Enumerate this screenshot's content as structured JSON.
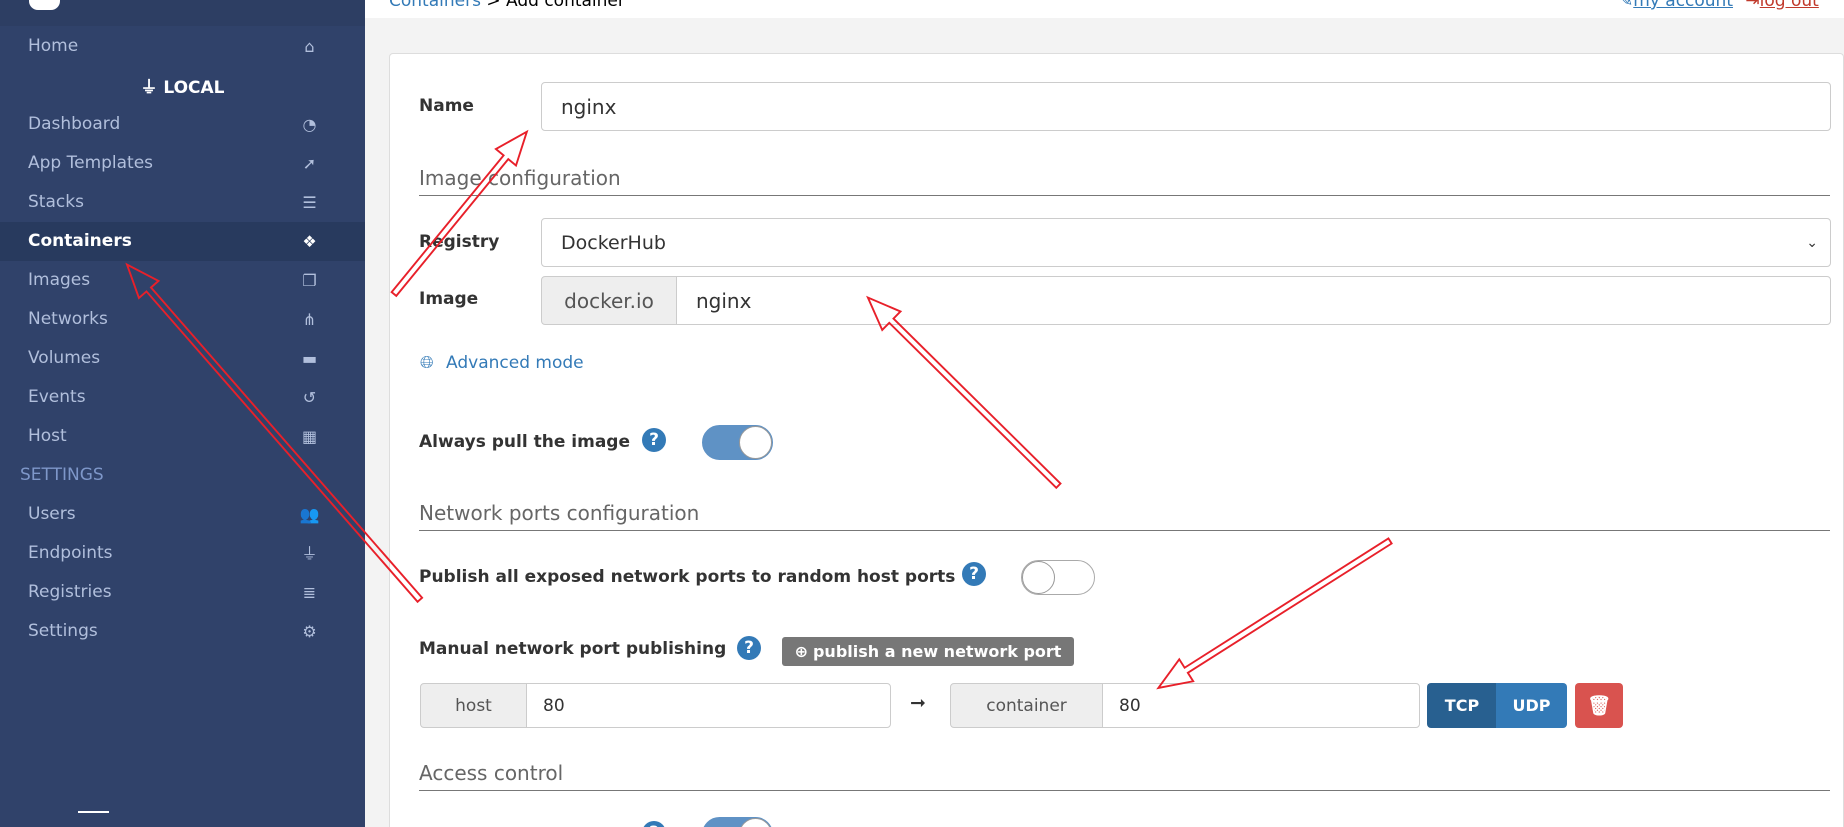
{
  "header": {
    "breadcrumb_link": "Containers",
    "breadcrumb_sep": " > ",
    "breadcrumb_current": "Add container",
    "my_account": "my account",
    "log_out": "log out"
  },
  "sidebar": {
    "home": {
      "label": "Home",
      "icon": "home-icon"
    },
    "endpoint": "LOCAL",
    "items": [
      {
        "label": "Dashboard",
        "icon": "tachometer-icon",
        "glyph": "◔"
      },
      {
        "label": "App Templates",
        "icon": "rocket-icon",
        "glyph": "➚"
      },
      {
        "label": "Stacks",
        "icon": "th-list-icon",
        "glyph": "☰"
      },
      {
        "label": "Containers",
        "icon": "cubes-icon",
        "glyph": "❖",
        "active": true
      },
      {
        "label": "Images",
        "icon": "clone-icon",
        "glyph": "❐"
      },
      {
        "label": "Networks",
        "icon": "sitemap-icon",
        "glyph": "⋔"
      },
      {
        "label": "Volumes",
        "icon": "hdd-icon",
        "glyph": "▬"
      },
      {
        "label": "Events",
        "icon": "history-icon",
        "glyph": "↺"
      },
      {
        "label": "Host",
        "icon": "th-icon",
        "glyph": "▦"
      }
    ],
    "settings_heading": "SETTINGS",
    "settings_items": [
      {
        "label": "Users",
        "icon": "users-icon",
        "glyph": "👥"
      },
      {
        "label": "Endpoints",
        "icon": "plug-icon",
        "glyph": "⏚"
      },
      {
        "label": "Registries",
        "icon": "database-icon",
        "glyph": "≣"
      },
      {
        "label": "Settings",
        "icon": "cogs-icon",
        "glyph": "⚙"
      }
    ]
  },
  "form": {
    "name_label": "Name",
    "name_value": "nginx",
    "image_config_heading": "Image configuration",
    "registry_label": "Registry",
    "registry_value": "DockerHub",
    "image_label": "Image",
    "image_prefix": "docker.io",
    "image_value": "nginx",
    "advanced_mode": "Advanced mode",
    "always_pull_label": "Always pull the image",
    "always_pull": true,
    "network_heading": "Network ports configuration",
    "publish_all_label": "Publish all exposed network ports to random host ports",
    "publish_all": false,
    "manual_label": "Manual network port publishing",
    "publish_new_button": "publish a new network port",
    "host_addon": "host",
    "host_value": "80",
    "arrow": "➞",
    "container_addon": "container",
    "container_value": "80",
    "tcp": "TCP",
    "udp": "UDP",
    "protocol_selected": "TCP",
    "access_heading": "Access control"
  },
  "colors": {
    "sidebar": "#30426a",
    "primary": "#337ab7",
    "primary_dark": "#286090",
    "danger": "#d9534f",
    "annotation": "#e8202a"
  }
}
